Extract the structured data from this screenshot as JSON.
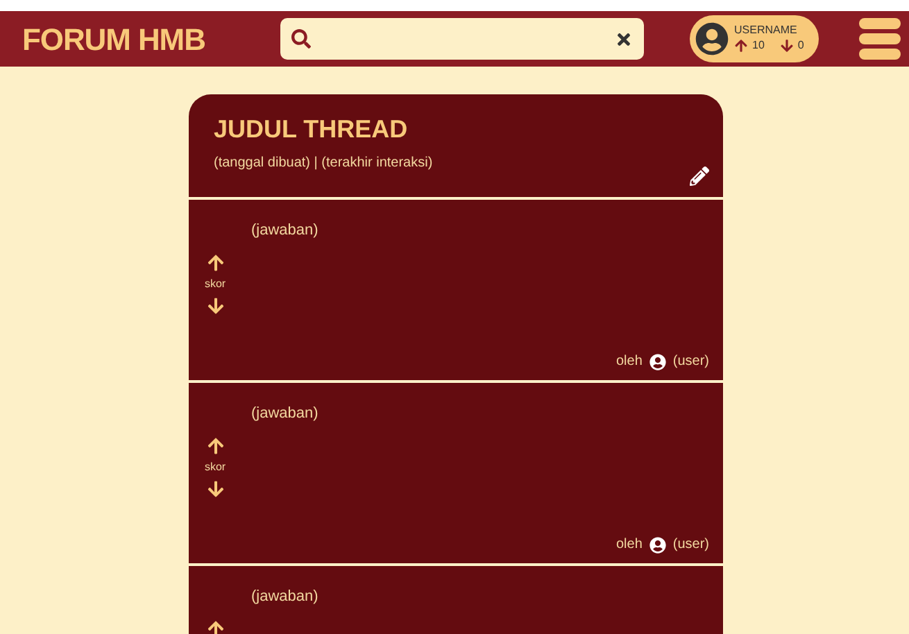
{
  "header": {
    "logo": "FORUM HMB",
    "user": {
      "name": "USERNAME",
      "upvotes": "10",
      "downvotes": "0"
    }
  },
  "thread": {
    "title": "JUDUL THREAD",
    "meta": "(tanggal dibuat) | (terakhir interaksi)",
    "replies": [
      {
        "answer": "(jawaban)",
        "score": "skor",
        "by": "oleh",
        "user": "(user)"
      },
      {
        "answer": "(jawaban)",
        "score": "skor",
        "by": "oleh",
        "user": "(user)"
      },
      {
        "answer": "(jawaban)"
      }
    ]
  }
}
